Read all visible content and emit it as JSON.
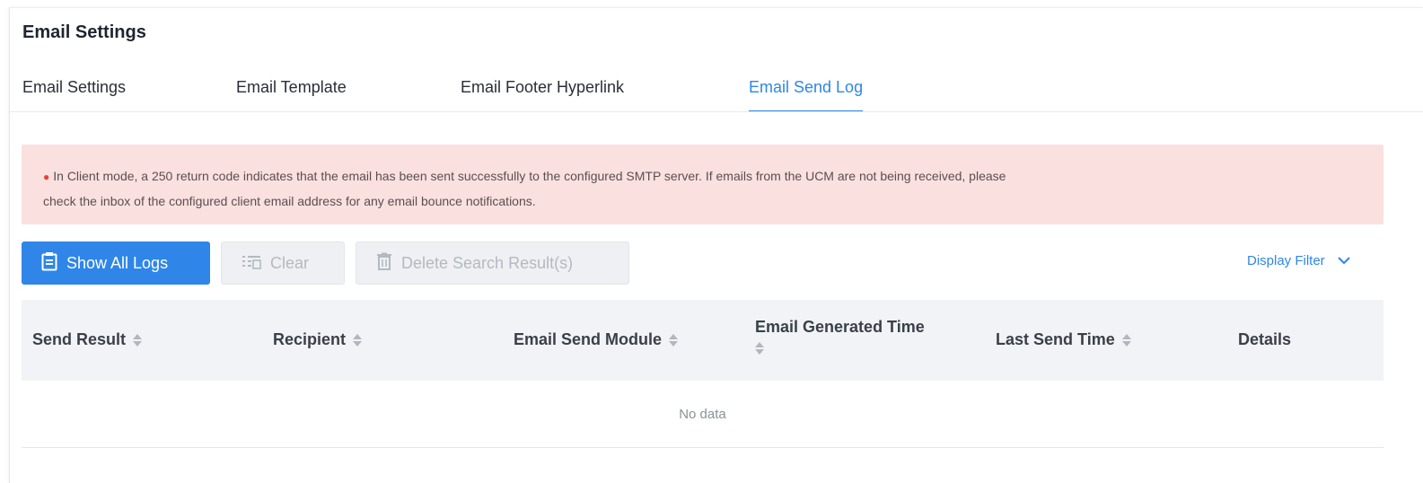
{
  "page": {
    "title": "Email Settings"
  },
  "tabs": [
    {
      "label": "Email Settings",
      "active": false
    },
    {
      "label": "Email Template",
      "active": false
    },
    {
      "label": "Email Footer Hyperlink",
      "active": false
    },
    {
      "label": "Email Send Log",
      "active": true
    }
  ],
  "alert": {
    "line1": "In Client mode, a 250 return code indicates that the email has been sent successfully to the configured SMTP server. If emails from the UCM are not being received, please",
    "line2": "check the inbox of the configured client email address for any email bounce notifications."
  },
  "toolbar": {
    "show_all_logs": "Show All Logs",
    "clear": "Clear",
    "delete_search_results": "Delete Search Result(s)",
    "display_filter": "Display Filter"
  },
  "table": {
    "columns": [
      {
        "label": "Send Result",
        "sortable": true
      },
      {
        "label": "Recipient",
        "sortable": true
      },
      {
        "label": "Email Send Module",
        "sortable": true
      },
      {
        "label": "Email Generated Time",
        "sortable": true
      },
      {
        "label": "Last Send Time",
        "sortable": true
      },
      {
        "label": "Details",
        "sortable": false
      }
    ],
    "empty_text": "No data"
  },
  "colors": {
    "accent": "#2f86e8",
    "alert_bg": "#fbe0e0",
    "alert_dot": "#e6403c",
    "header_bg": "#f1f3f6"
  },
  "icons": {
    "show_all_logs": "clipboard-list-icon",
    "clear": "clear-list-icon",
    "delete": "trash-icon",
    "display_filter": "chevron-down-icon"
  }
}
